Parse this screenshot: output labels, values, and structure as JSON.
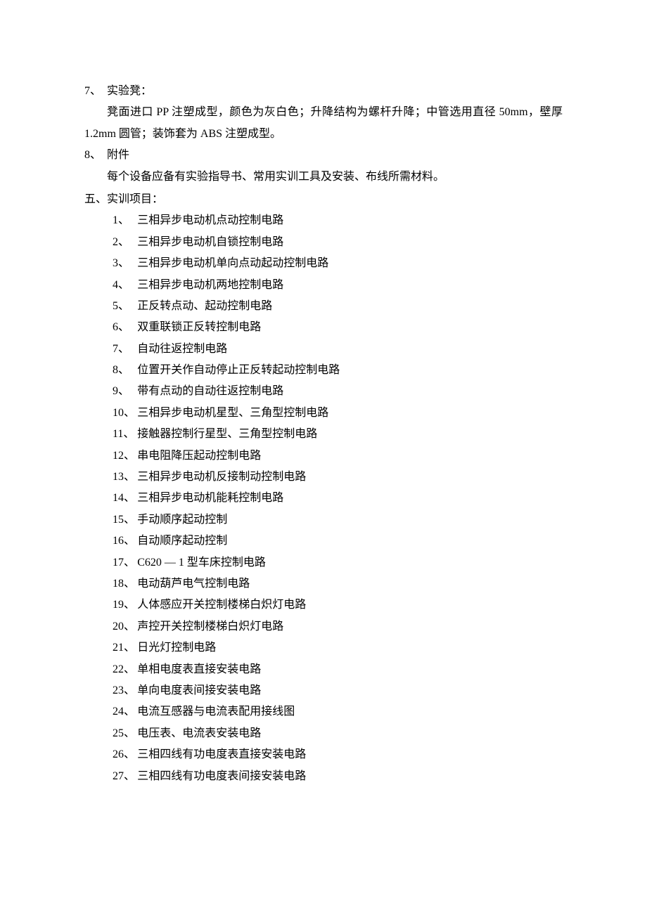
{
  "section7": {
    "num": "7、",
    "title": "实验凳：",
    "body": "凳面进口 PP 注塑成型，颜色为灰白色；升降结构为螺杆升降；中管选用直径 50mm，壁厚 1.2mm 圆管；装饰套为 ABS 注塑成型。"
  },
  "section8": {
    "num": "8、",
    "title": "附件",
    "body": "每个设备应备有实验指导书、常用实训工具及安装、布线所需材料。"
  },
  "section5heading": {
    "num": "五、",
    "title": "实训项目："
  },
  "training_items": [
    {
      "idx": "1、",
      "text": "三相异步电动机点动控制电路"
    },
    {
      "idx": "2、",
      "text": "三相异步电动机自锁控制电路"
    },
    {
      "idx": "3、",
      "text": "三相异步电动机单向点动起动控制电路"
    },
    {
      "idx": "4、",
      "text": "三相异步电动机两地控制电路"
    },
    {
      "idx": "5、",
      "text": "正反转点动、起动控制电路"
    },
    {
      "idx": "6、",
      "text": "双重联锁正反转控制电路"
    },
    {
      "idx": "7、",
      "text": "自动往返控制电路"
    },
    {
      "idx": "8、",
      "text": "位置开关作自动停止正反转起动控制电路"
    },
    {
      "idx": "9、",
      "text": "带有点动的自动往返控制电路"
    },
    {
      "idx": "10、",
      "text": "三相异步电动机星型、三角型控制电路"
    },
    {
      "idx": "11、",
      "text": "接触器控制行星型、三角型控制电路"
    },
    {
      "idx": "12、",
      "text": "串电阻降压起动控制电路"
    },
    {
      "idx": "13、",
      "text": "三相异步电动机反接制动控制电路"
    },
    {
      "idx": "14、",
      "text": "三相异步电动机能耗控制电路"
    },
    {
      "idx": "15、",
      "text": "手动顺序起动控制"
    },
    {
      "idx": "16、",
      "text": "自动顺序起动控制"
    },
    {
      "idx": "17、",
      "text": "C620 — 1 型车床控制电路"
    },
    {
      "idx": "18、",
      "text": "电动葫芦电气控制电路"
    },
    {
      "idx": "19、",
      "text": "人体感应开关控制楼梯白炽灯电路"
    },
    {
      "idx": "20、",
      "text": "声控开关控制楼梯白炽灯电路"
    },
    {
      "idx": "21、",
      "text": "日光灯控制电路"
    },
    {
      "idx": "22、",
      "text": "单相电度表直接安装电路"
    },
    {
      "idx": "23、",
      "text": "单向电度表间接安装电路"
    },
    {
      "idx": "24、",
      "text": "电流互感器与电流表配用接线图"
    },
    {
      "idx": "25、",
      "text": "电压表、电流表安装电路"
    },
    {
      "idx": "26、",
      "text": "三相四线有功电度表直接安装电路"
    },
    {
      "idx": "27、",
      "text": "三相四线有功电度表间接安装电路"
    }
  ]
}
